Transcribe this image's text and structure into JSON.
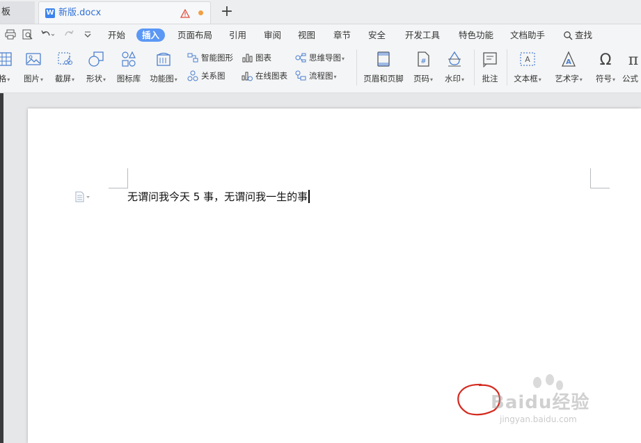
{
  "tabs": {
    "prev_label": "板",
    "doc_icon": "W",
    "doc_title": "新版.docx",
    "add_label": "+"
  },
  "menu": {
    "items": [
      {
        "label": "开始"
      },
      {
        "label": "插入"
      },
      {
        "label": "页面布局"
      },
      {
        "label": "引用"
      },
      {
        "label": "审阅"
      },
      {
        "label": "视图"
      },
      {
        "label": "章节"
      },
      {
        "label": "安全"
      },
      {
        "label": "开发工具"
      },
      {
        "label": "特色功能"
      },
      {
        "label": "文档助手"
      },
      {
        "label": "查找"
      }
    ]
  },
  "ribbon": {
    "table": "格",
    "picture": "图片",
    "screenshot": "截屏",
    "shapes": "形状",
    "icon_library": "图标库",
    "function_chart": "功能图",
    "smart_art": "智能图形",
    "relation_chart": "关系图",
    "chart": "图表",
    "online_chart": "在线图表",
    "mind_map": "思维导图",
    "flowchart": "流程图",
    "header_footer": "页眉和页脚",
    "page_number": "页码",
    "watermark": "水印",
    "comment": "批注",
    "textbox": "文本框",
    "word_art": "艺术字",
    "symbol": "符号",
    "formula": "公式"
  },
  "document": {
    "text": "无谓问我今天 5 事，无谓问我一生的事"
  },
  "watermark": {
    "brand": "Baidu经验",
    "url": "jingyan.baidu.com"
  },
  "colors": {
    "accent": "#5b98f5",
    "warning": "#e04a3a",
    "unsaved_dot": "#f0a042",
    "annotation_circle": "#d42a1f"
  }
}
